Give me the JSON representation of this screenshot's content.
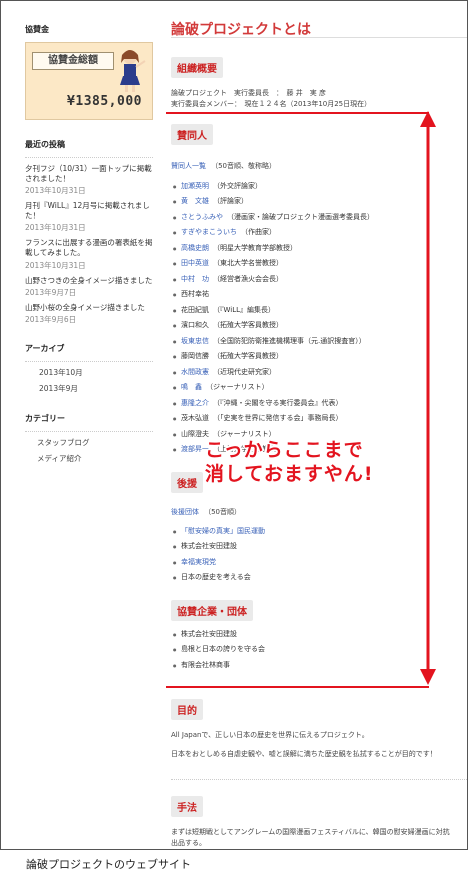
{
  "sidebar": {
    "sponsor_head": "協賛金",
    "banner_title": "協賛金総額",
    "banner_amount": "¥1385,000",
    "recent_head": "最近の投稿",
    "posts": [
      {
        "title": "夕刊フジ（10/31）一面トップに掲載されました！",
        "date": "2013年10月31日"
      },
      {
        "title": "月刊『WiLL』12月号に掲載されました！",
        "date": "2013年10月31日"
      },
      {
        "title": "フランスに出展する漫画の署表紙を掲載してみました。",
        "date": "2013年10月31日"
      },
      {
        "title": "山野さつきの全身イメージ描きました",
        "date": "2013年9月7日"
      },
      {
        "title": "山野小桜の全身イメージ描きました",
        "date": "2013年9月6日"
      }
    ],
    "archive_head": "アーカイブ",
    "archives": [
      "2013年10月",
      "2013年9月"
    ],
    "category_head": "カテゴリー",
    "categories": [
      "スタッフブログ",
      "メディア紹介"
    ]
  },
  "main": {
    "title": "論破プロジェクトとは",
    "overview_head": "組織概要",
    "overview_line1": "論破プロジェクト　実行委員長　：　藤 井　実 彦",
    "overview_line2": "実行委員会メンバー：　現在１２４名（2013年10月25日現在）",
    "supporters_head": "賛同人",
    "supporters_link": "賛同人一覧",
    "supporters_note": "（50音順、敬称略）",
    "supporters": [
      {
        "name": "加瀬英明",
        "note": "（外交評論家）"
      },
      {
        "name": "黄　文雄",
        "note": "（評論家）"
      },
      {
        "name": "さとうふみや",
        "note": "（漫画家・論破プロジェクト漫画選考委員長）"
      },
      {
        "name": "すぎやまこういち",
        "note": "（作曲家）"
      },
      {
        "name": "高橋史朗",
        "note": "（明星大学教育学部教授）"
      },
      {
        "name": "田中英道",
        "note": "（東北大学名誉教授）"
      },
      {
        "name": "中村　功",
        "note": "（経営者漁火会会長）"
      },
      {
        "name": "西村幸祐",
        "note": ""
      },
      {
        "name": "花田紀凱",
        "note": "（『WiLL』編集長）"
      },
      {
        "name": "濱口和久",
        "note": "（拓殖大学客員教授）"
      },
      {
        "name": "坂東忠信",
        "note": "（全国防犯防衛推進機構理事（元.通訳捜査官））"
      },
      {
        "name": "藤岡信勝",
        "note": "（拓殖大学客員教授）"
      },
      {
        "name": "水間政憲",
        "note": "（近現代史研究家）"
      },
      {
        "name": "鳴　鑫",
        "note": "（ジャーナリスト）"
      },
      {
        "name": "惠隆之介",
        "note": "（『沖縄・尖閣を守る実行委員会』代表）"
      },
      {
        "name": "茂木弘道",
        "note": "（「史実を世界に発信する会」事務局長）"
      },
      {
        "name": "山際澄夫",
        "note": "（ジャーナリスト）"
      },
      {
        "name": "渡部昇一",
        "note": "（上智大学名誉教授）"
      }
    ],
    "support_head": "後援",
    "support_link": "後援団体",
    "support_note": "（50音順）",
    "support_orgs": [
      "「慰安婦の真実」国民運動",
      "株式会社安田建設",
      "幸福実現党",
      "日本の歴史を考える会"
    ],
    "companies_head": "協賛企業・団体",
    "companies": [
      "株式会社安田建設",
      "島根と日本の誇りを守る会",
      "有限会社林商事"
    ],
    "purpose_head": "目的",
    "purpose_line1": "All Japanで、正しい日本の歴史を世界に伝えるプロジェクト。",
    "purpose_line2": "日本をおとしめる自虐史観や、嘘と誤解に満ちた歴史観を払拭することが目的です！",
    "method_head": "手法",
    "method_line1": "まずは短期戦としてアングレームの国際漫画フェスティバルに、韓国の慰安婦漫画に対抗",
    "method_line2": "出品する。"
  },
  "overlay": {
    "line1": "こっからここまで",
    "line2": "消しておますやん!"
  },
  "caption": "論破プロジェクトのウェブサイト",
  "colors": {
    "accent": "#e3141f",
    "title": "#d23a3a",
    "link": "#3a62b8"
  }
}
